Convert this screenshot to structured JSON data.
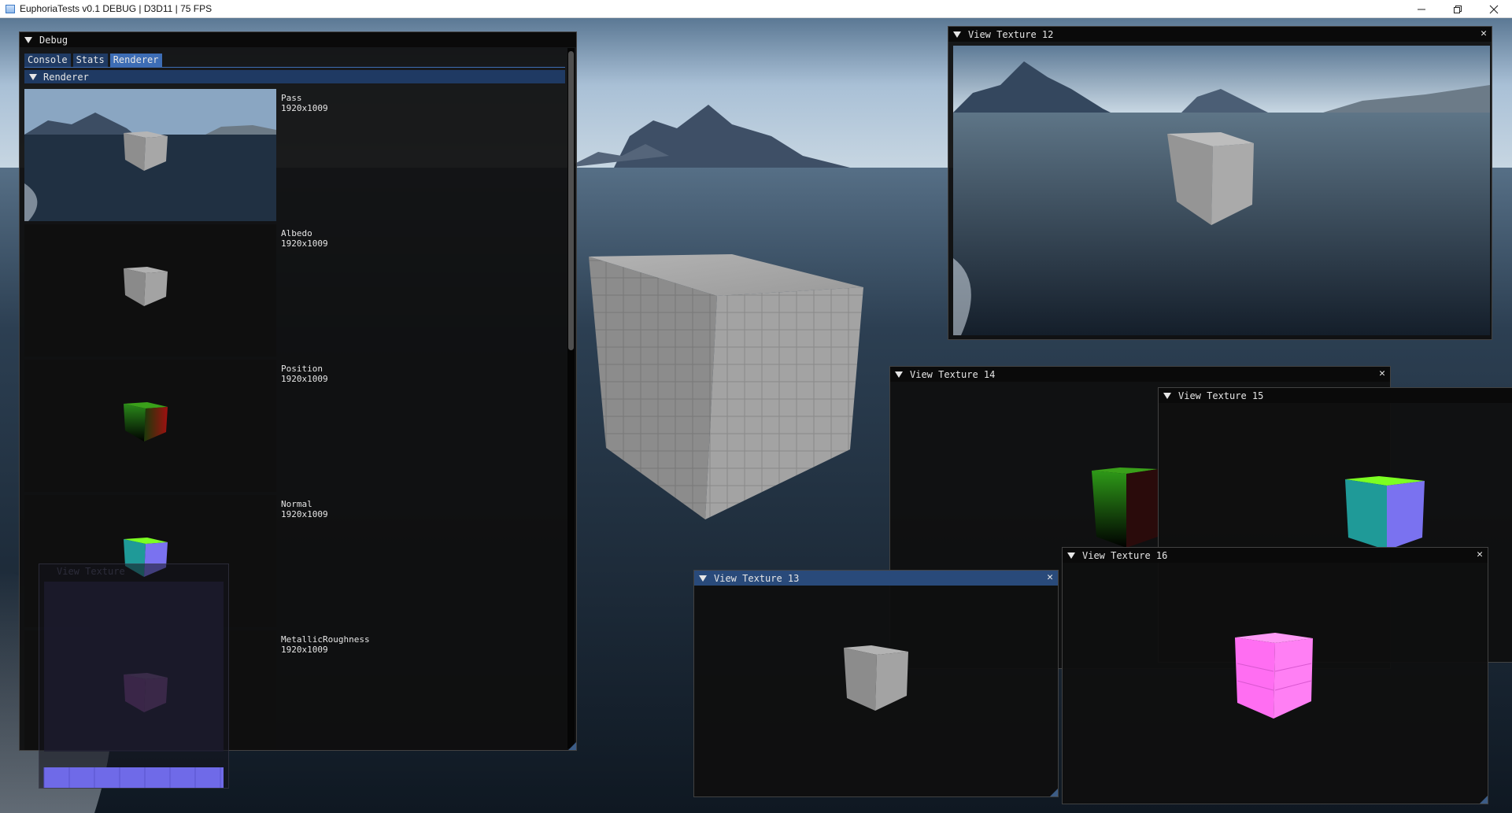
{
  "os_window": {
    "title": "EuphoriaTests v0.1 DEBUG | D3D11 | 75 FPS",
    "controls": [
      "minimize-icon",
      "restore-icon",
      "close-icon"
    ]
  },
  "debug_window": {
    "title": "Debug",
    "tabs": [
      {
        "label": "Console"
      },
      {
        "label": "Stats"
      },
      {
        "label": "Renderer"
      }
    ],
    "selected_tab": "Renderer",
    "section_title": "Renderer",
    "textures": [
      {
        "name": "Pass",
        "size": "1920x1009",
        "kind": "scene"
      },
      {
        "name": "Albedo",
        "size": "1920x1009",
        "kind": "albedo"
      },
      {
        "name": "Position",
        "size": "1920x1009",
        "kind": "position"
      },
      {
        "name": "Normal",
        "size": "1920x1009",
        "kind": "normal"
      },
      {
        "name": "MetallicRoughness",
        "size": "1920x1009",
        "kind": "metal"
      }
    ]
  },
  "ghost_window": {
    "title": "View Texture"
  },
  "texture_windows": [
    {
      "title": "View Texture 12",
      "kind": "scene"
    },
    {
      "title": "View Texture 14",
      "kind": "position"
    },
    {
      "title": "View Texture 15",
      "kind": "normal"
    },
    {
      "title": "View Texture 13",
      "kind": "albedo"
    },
    {
      "title": "View Texture 16",
      "kind": "metal"
    }
  ],
  "colors": {
    "imgui_window_bg": "#0f0f0f",
    "imgui_title_active": "#294a7a",
    "imgui_tab": "#1f3a63",
    "imgui_tab_selected": "#3d6db5",
    "sky": "#7fa2c4",
    "water": "#1c2a38",
    "cube_gray": "#9b9b9b",
    "metal_pink": "#ff6ef2",
    "normal_blue": "#7a72f0",
    "normal_green": "#7cff22",
    "normal_teal": "#1f9a98"
  }
}
